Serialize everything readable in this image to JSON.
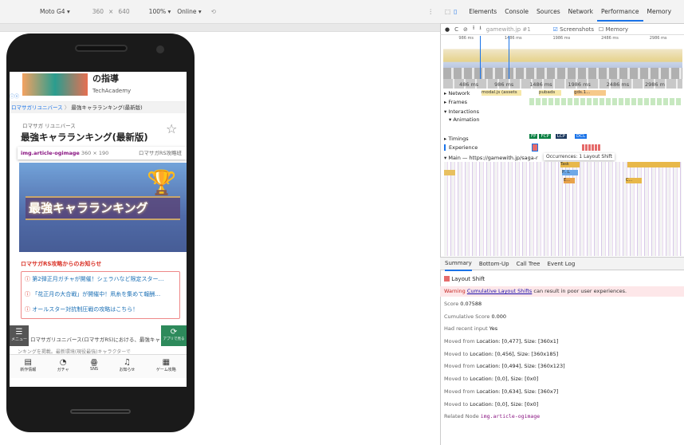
{
  "device_toolbar": {
    "device": "Moto G4 ▾",
    "width": "360",
    "times": "×",
    "height": "640",
    "zoom": "100% ▾",
    "network": "Online ▾"
  },
  "mobile_page": {
    "banner_title": "の指導",
    "banner_sub": "TechAcademy",
    "breadcrumb_home": "ロマサガリユニバース",
    "breadcrumb_sep": "〉",
    "breadcrumb_current": "最強キャラランキング(最新版)",
    "category": "ロマサガ リユニバース",
    "title": "最強キャラランキング(最新版)",
    "tooltip_tag": "img.article-ogimage",
    "tooltip_size": "360 × 190",
    "tooltip_right": "ロマサガRS攻略班",
    "hero_text": "最強キャラランキング",
    "notice_heading": "ロマサガRS攻略からのお知らせ",
    "notices": [
      "第2弾正月ガチャが開催！シェラハなど限定スター…",
      "「花正月の大合戦」が開催中！凧糸を集めて報酬…",
      "オールスター対抗制圧戦の攻略はこちら！"
    ],
    "intro_text": "ロマサガリユニバース(ロマサガRS)における、最強キャラ",
    "intro_text2": "ンキングを掲載。最新環境(現役最強)キャラクターで",
    "menu_label": "メニュー",
    "app_label": "アプリで見る",
    "nav": [
      "新作情報",
      "ガチャ",
      "SNS",
      "お知らせ",
      "ゲーム攻略"
    ]
  },
  "devtools": {
    "tabs": [
      "Elements",
      "Console",
      "Sources",
      "Network",
      "Performance",
      "Memory"
    ],
    "active_tab": "Performance",
    "url": "gamewith.jp #1",
    "screenshots_label": "Screenshots",
    "memory_label": "Memory",
    "overview_ticks": [
      "986 ms",
      "1486 ms",
      "1986 ms",
      "2486 ms",
      "2986 ms"
    ],
    "ruler_ticks": [
      "486 ms",
      "986 ms",
      "1486 ms",
      "1986 ms",
      "2486 ms",
      "2986 m"
    ],
    "tracks": {
      "network": "Network",
      "network_detail": "modal.js (assets",
      "pubads": "pubads",
      "gds": "gds.1...",
      "frames": "Frames",
      "interactions": "Interactions",
      "animation": "Animation",
      "timings": "Timings",
      "experience": "Experience",
      "main": "Main — https://gamewith.jp/saga-r",
      "occurrences": "Occurrences: 1 Layout Shift",
      "task": "Task",
      "p": "P...L",
      "e": "E...",
      "c": "C..."
    },
    "markers": [
      "FP",
      "FCP",
      "LCP",
      "DCL"
    ],
    "bottom_tabs": [
      "Summary",
      "Bottom-Up",
      "Call Tree",
      "Event Log"
    ],
    "summary": {
      "title": "Layout Shift",
      "warning_label": "Warning",
      "warning_link": "Cumulative Layout Shifts",
      "warning_text": "can result in poor user experiences.",
      "score_label": "Score",
      "score": "0.07588",
      "cumulative_label": "Cumulative Score",
      "cumulative": "0.000",
      "recent_label": "Had recent input",
      "recent": "Yes",
      "rows": [
        {
          "label": "Moved from",
          "value": "Location: [0,477], Size: [360x1]"
        },
        {
          "label": "Moved to",
          "value": "Location: [0,456], Size: [360x185]"
        },
        {
          "label": "Moved from",
          "value": "Location: [0,494], Size: [360x123]"
        },
        {
          "label": "Moved to",
          "value": "Location: [0,0], Size: [0x0]"
        },
        {
          "label": "Moved from",
          "value": "Location: [0,634], Size: [360x7]"
        },
        {
          "label": "Moved to",
          "value": "Location: [0,0], Size: [0x0]"
        }
      ],
      "related_label": "Related Node",
      "related": "img.article-ogimage"
    }
  },
  "colors": {
    "accent": "#1a73e8",
    "warning_bg": "#fde7e9",
    "red": "#d93025",
    "hero": "#3b4a8c"
  }
}
